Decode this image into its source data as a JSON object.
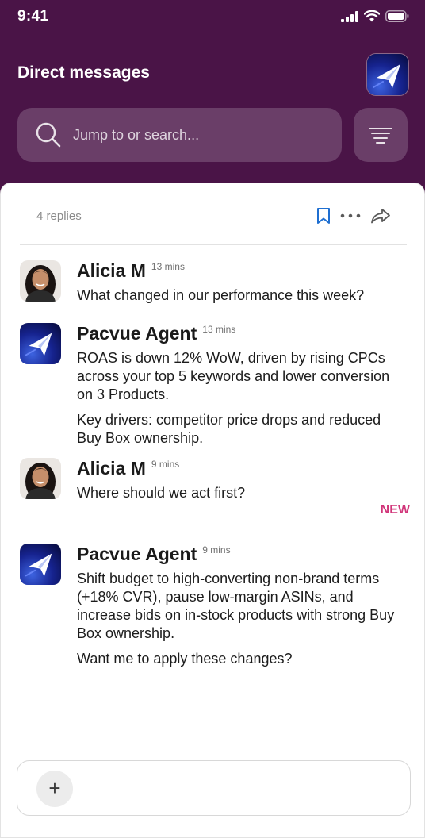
{
  "status_bar": {
    "time": "9:41"
  },
  "header": {
    "title": "Direct messages",
    "search_placeholder": "Jump to or search..."
  },
  "thread": {
    "replies_label": "4 replies",
    "new_label": "NEW"
  },
  "messages": [
    {
      "sender": "Alicia M",
      "time": "13 mins",
      "paragraphs": [
        "What changed in our performance this week?"
      ]
    },
    {
      "sender": "Pacvue Agent",
      "time": "13 mins",
      "paragraphs": [
        "ROAS is down 12% WoW, driven by rising CPCs across your top 5 keywords and lower conversion on 3 Products.",
        "Key drivers: competitor price drops and reduced Buy Box ownership."
      ]
    },
    {
      "sender": "Alicia M",
      "time": "9 mins",
      "paragraphs": [
        "Where should we act first?"
      ]
    },
    {
      "sender": "Pacvue Agent",
      "time": "9 mins",
      "paragraphs": [
        "Shift budget to high-converting non-brand terms (+18% CVR), pause low-margin ASINs, and increase bids on in-stock products with strong Buy Box ownership.",
        "Want me to apply these changes?"
      ]
    }
  ],
  "composer": {
    "add_label": "+"
  },
  "colors": {
    "header_bg": "#4a1447",
    "new_accent": "#d1367a",
    "bookmark_blue": "#1f6fd1"
  }
}
